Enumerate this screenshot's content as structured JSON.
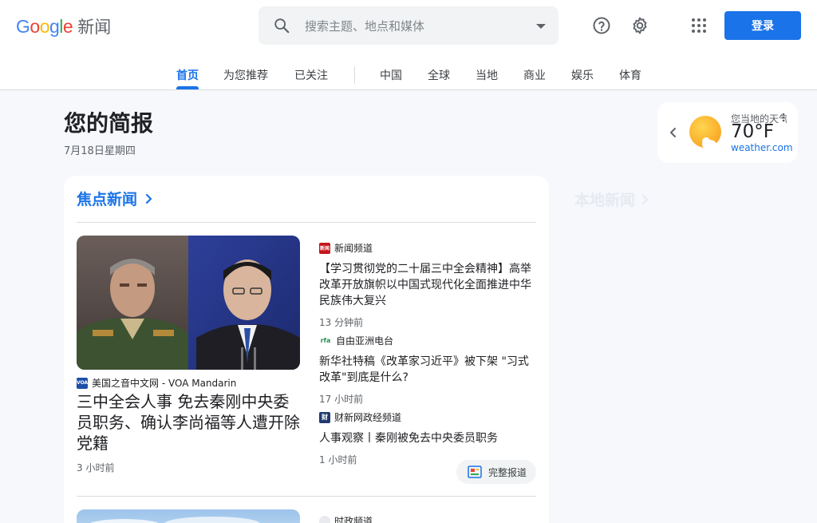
{
  "header": {
    "logo_google": "Google",
    "logo_news": "新闻",
    "search_placeholder": "搜索主题、地点和媒体",
    "login_label": "登录"
  },
  "tabs": [
    "首页",
    "为您推荐",
    "已关注",
    "中国",
    "全球",
    "当地",
    "商业",
    "娱乐",
    "体育"
  ],
  "active_tab": "首页",
  "briefing": {
    "title": "您的简报",
    "date": "7月18日星期四"
  },
  "weather": {
    "label": "您当地的天气",
    "temp": "70°F",
    "source": "weather.com"
  },
  "local_news_title": "本地新闻",
  "top_stories": {
    "title": "焦点新闻",
    "main": {
      "source": "美国之音中文网 - VOA Mandarin",
      "source_logo": "VOA",
      "headline": "三中全会人事 免去秦刚中央委员职务、确认李尚福等人遭开除党籍",
      "time": "3 小时前"
    },
    "side": [
      {
        "source": "新闻频道",
        "source_logo": "新闻",
        "headline": "【学习贯彻党的二十届三中全会精神】高举改革开放旗帜以中国式现代化全面推进中华民族伟大复兴",
        "time": "13 分钟前"
      },
      {
        "source": "自由亚洲电台",
        "source_logo": "rfa",
        "headline": "新华社特稿《改革家习近平》被下架 \"习式改革\"到底是什么?",
        "time": "17 小时前"
      },
      {
        "source": "财新网政经频道",
        "source_logo": "财",
        "headline": "人事观察丨秦刚被免去中央委员职务",
        "time": "1 小时前"
      }
    ],
    "full_coverage": "完整报道",
    "next_source": "时政频道"
  },
  "colors": {
    "accent": "#1a73e8",
    "background": "#f6f8fc",
    "google_blue": "#4285F4",
    "google_red": "#EA4335",
    "google_yellow": "#FBBC05",
    "google_green": "#34A853"
  }
}
